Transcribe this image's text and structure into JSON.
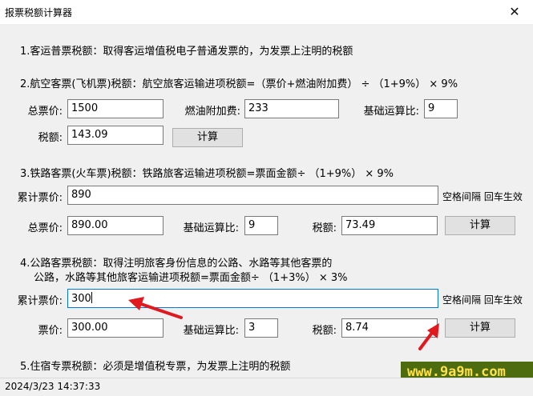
{
  "window": {
    "title": "报票税额计算器",
    "close_glyph": "✕"
  },
  "sections": {
    "s1": {
      "text": "1.客运普票税额：取得客运增值税电子普通发票的，为发票上注明的税额"
    },
    "s2": {
      "text": "2.航空客票(飞机票)税额：航空旅客运输进项税额=（票价+燃油附加费） ÷ （1+9%） × 9%",
      "total_label": "总票价:",
      "total_value": "1500",
      "fuel_label": "燃油附加费:",
      "fuel_value": "233",
      "ratio_label": "基础运算比:",
      "ratio_value": "9",
      "tax_label": "税额:",
      "tax_value": "143.09",
      "calc_label": "计算"
    },
    "s3": {
      "text": "3.铁路客票(火车票)税额：铁路旅客运输进项税额=票面金额÷ （1+9%） × 9%",
      "cum_label": "累计票价:",
      "cum_value": "890",
      "hint": "空格间隔 回车生效",
      "total_label": "总票价:",
      "total_value": "890.00",
      "ratio_label": "基础运算比:",
      "ratio_value": "9",
      "tax_label": "税额:",
      "tax_value": "73.49",
      "calc_label": "计算"
    },
    "s4": {
      "text_line1": "4.公路客票税额：取得注明旅客身份信息的公路、水路等其他客票的",
      "text_line2": "公路，水路等其他旅客运输进项税额=票面金额÷ （1+3%） × 3%",
      "cum_label": "累计票价:",
      "cum_value": "300",
      "hint": "空格间隔 回车生效",
      "price_label": "票价:",
      "price_value": "300.00",
      "ratio_label": "基础运算比:",
      "ratio_value": "3",
      "tax_label": "税额:",
      "tax_value": "8.74",
      "calc_label": "计算"
    },
    "s5": {
      "text": "5.住宿专票税额：必须是增值税专票，为发票上注明的税额"
    }
  },
  "status": {
    "datetime": "2024/3/23 14:37:33"
  },
  "watermark": {
    "text": "www.9a9m.com"
  },
  "colors": {
    "arrow": "#e0191e",
    "watermark_bg": "#4d6b0f",
    "watermark_fg": "#ffe14d",
    "focus": "#0078d7"
  }
}
